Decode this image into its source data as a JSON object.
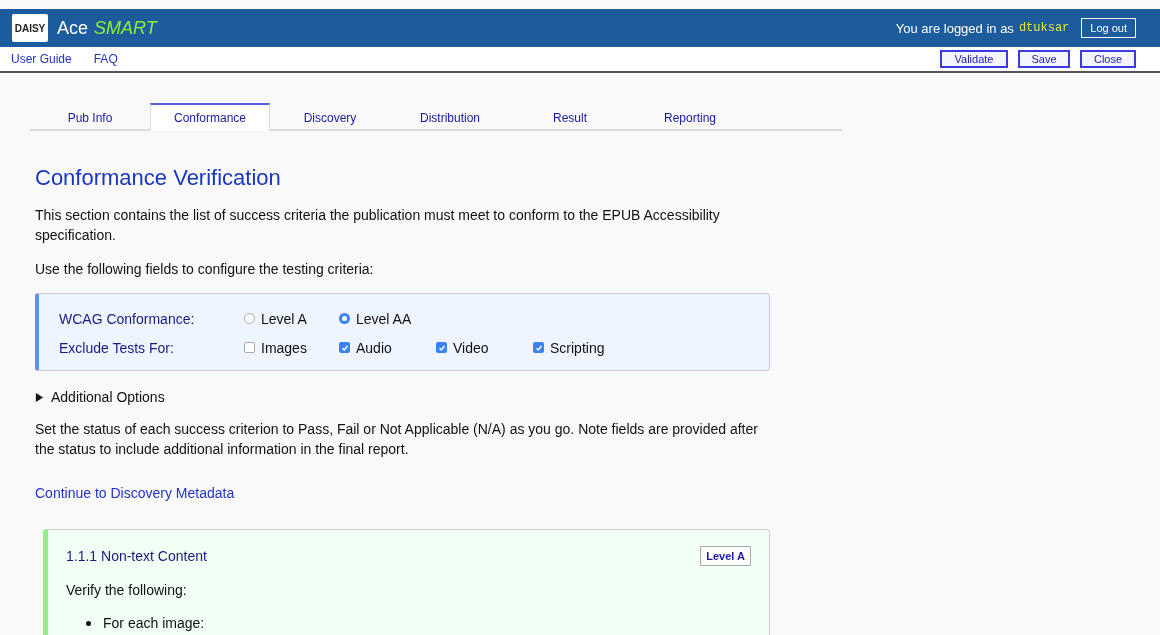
{
  "header": {
    "logo": "DAISY",
    "app_name": "Ace",
    "app_name_accent": "SMART",
    "login_text": "You are logged in as",
    "username": "dtuksar",
    "logout": "Log out"
  },
  "nav": {
    "links": [
      "User Guide",
      "FAQ"
    ],
    "buttons": [
      "Validate",
      "Save",
      "Close"
    ]
  },
  "tabs": [
    {
      "label": "Pub Info",
      "selected": false
    },
    {
      "label": "Conformance",
      "selected": true
    },
    {
      "label": "Discovery",
      "selected": false
    },
    {
      "label": "Distribution",
      "selected": false
    },
    {
      "label": "Result",
      "selected": false
    },
    {
      "label": "Reporting",
      "selected": false
    }
  ],
  "heading": "Conformance Verification",
  "intro": "This section contains the list of success criteria the publication must meet to conform to the EPUB Accessibility specification.",
  "fields_intro": "Use the following fields to configure the testing criteria:",
  "options": [
    {
      "label": "WCAG Conformance:",
      "kind": "radio",
      "choices": [
        {
          "label": "Level A",
          "selected": false
        },
        {
          "label": "Level AA",
          "selected": true
        }
      ]
    },
    {
      "label": "Exclude Tests For:",
      "kind": "checkbox",
      "choices": [
        {
          "label": "Images",
          "checked": false
        },
        {
          "label": "Audio",
          "checked": true
        },
        {
          "label": "Video",
          "checked": true
        },
        {
          "label": "Scripting",
          "checked": true
        }
      ]
    }
  ],
  "additional_options": {
    "label": "Additional Options",
    "expanded": false
  },
  "status_note": "Set the status of each success criterion to Pass, Fail or Not Applicable (N/A) as you go. Note fields are provided after the status to include additional information in the final report.",
  "continue_link": "Continue to Discovery Metadata",
  "criterion": {
    "title": "1.1.1 Non-text Content",
    "level": "Level A",
    "instruction": "Verify the following:",
    "items": [
      "For each image:"
    ]
  }
}
